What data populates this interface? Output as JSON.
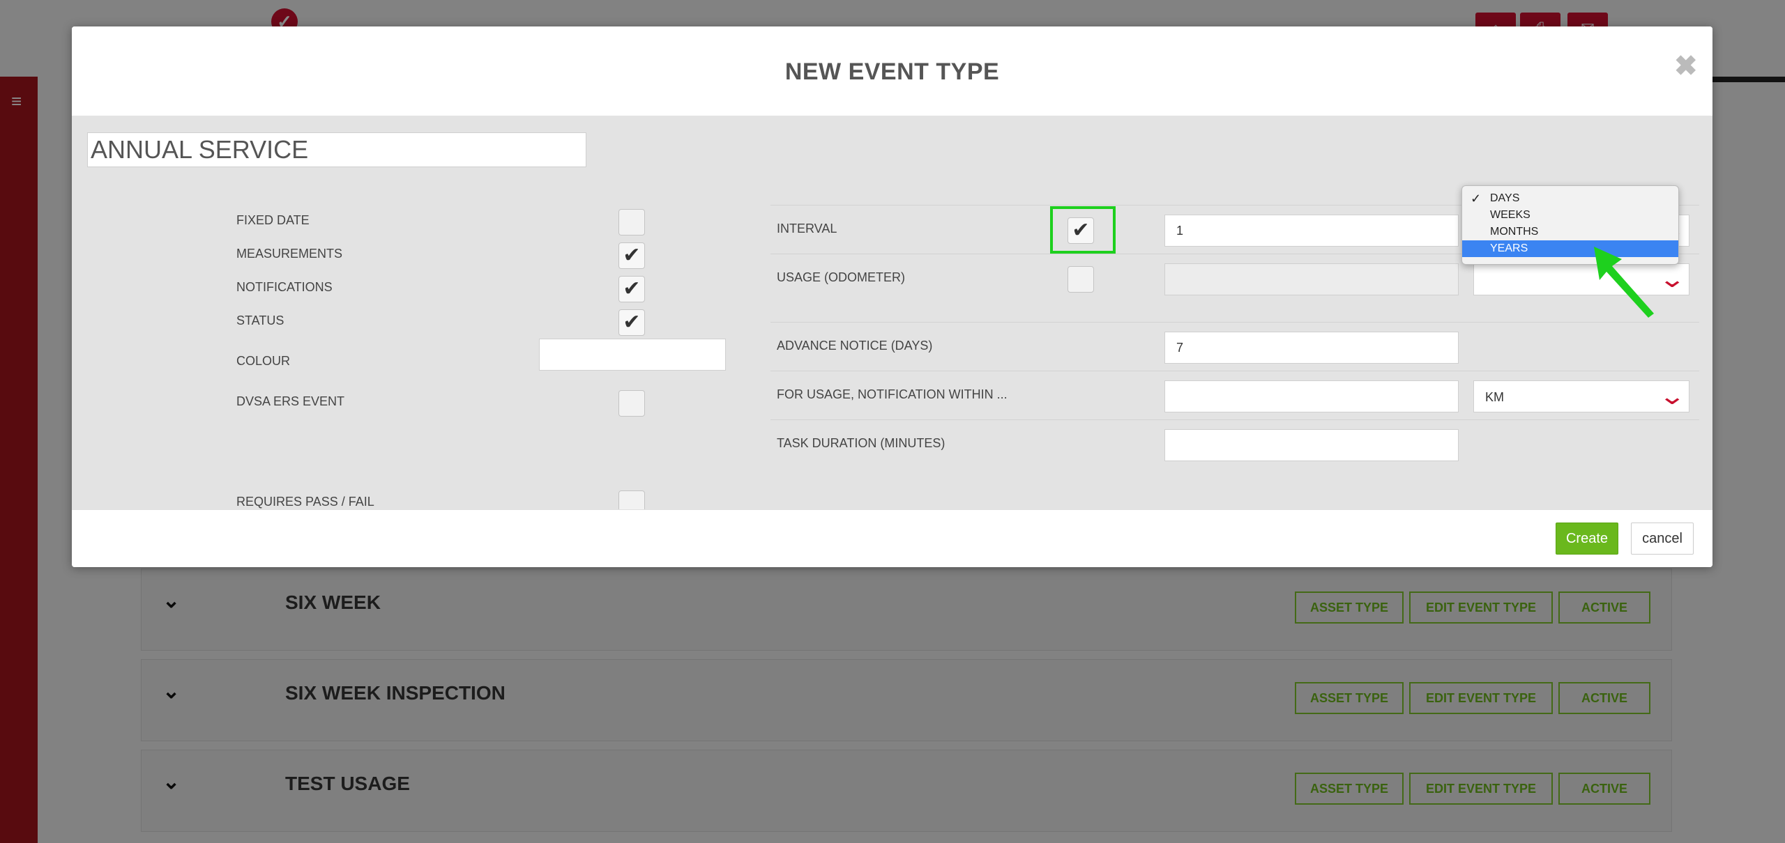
{
  "background": {
    "top_icons": [
      "home-icon",
      "printer-icon",
      "mail-icon"
    ],
    "event_rows": [
      {
        "title": "SIX WEEK",
        "buttons": [
          "ASSET TYPE",
          "EDIT EVENT TYPE",
          "ACTIVE"
        ]
      },
      {
        "title": "SIX WEEK INSPECTION",
        "buttons": [
          "ASSET TYPE",
          "EDIT EVENT TYPE",
          "ACTIVE"
        ]
      },
      {
        "title": "TEST USAGE",
        "buttons": [
          "ASSET TYPE",
          "EDIT EVENT TYPE",
          "ACTIVE"
        ]
      }
    ]
  },
  "modal": {
    "title": "NEW EVENT TYPE",
    "close_glyph": "✖",
    "name_value": "ANNUAL SERVICE",
    "left_fields": {
      "fixed_date": {
        "label": "FIXED DATE",
        "checked": false
      },
      "measurements": {
        "label": "MEASUREMENTS",
        "checked": true
      },
      "notifications": {
        "label": "NOTIFICATIONS",
        "checked": true
      },
      "status": {
        "label": "STATUS",
        "checked": true
      },
      "colour": {
        "label": "COLOUR",
        "value": ""
      },
      "dvsa": {
        "label": "DVSA ERS EVENT",
        "checked": false
      },
      "pass_fail": {
        "label": "REQUIRES PASS / FAIL",
        "checked": false
      }
    },
    "right_fields": {
      "interval": {
        "label": "INTERVAL",
        "checked": true,
        "value": "1"
      },
      "usage": {
        "label": "USAGE (ODOMETER)",
        "checked": false,
        "value": ""
      },
      "advance_notice": {
        "label": "ADVANCE NOTICE (DAYS)",
        "value": "7"
      },
      "usage_notification": {
        "label": "FOR USAGE, NOTIFICATION WITHIN ...",
        "value": "",
        "unit": "KM"
      },
      "task_duration": {
        "label": "TASK DURATION (MINUTES)",
        "value": ""
      }
    },
    "interval_dropdown": {
      "options": [
        "DAYS",
        "WEEKS",
        "MONTHS",
        "YEARS"
      ],
      "checked": "DAYS",
      "highlighted": "YEARS"
    },
    "footer": {
      "create_label": "Create",
      "cancel_label": "cancel"
    }
  },
  "colors": {
    "accent_green": "#6ab81d",
    "brand_red": "#c8102e",
    "highlight_green": "#1ed01e",
    "dropdown_highlight": "#3b84f2"
  }
}
